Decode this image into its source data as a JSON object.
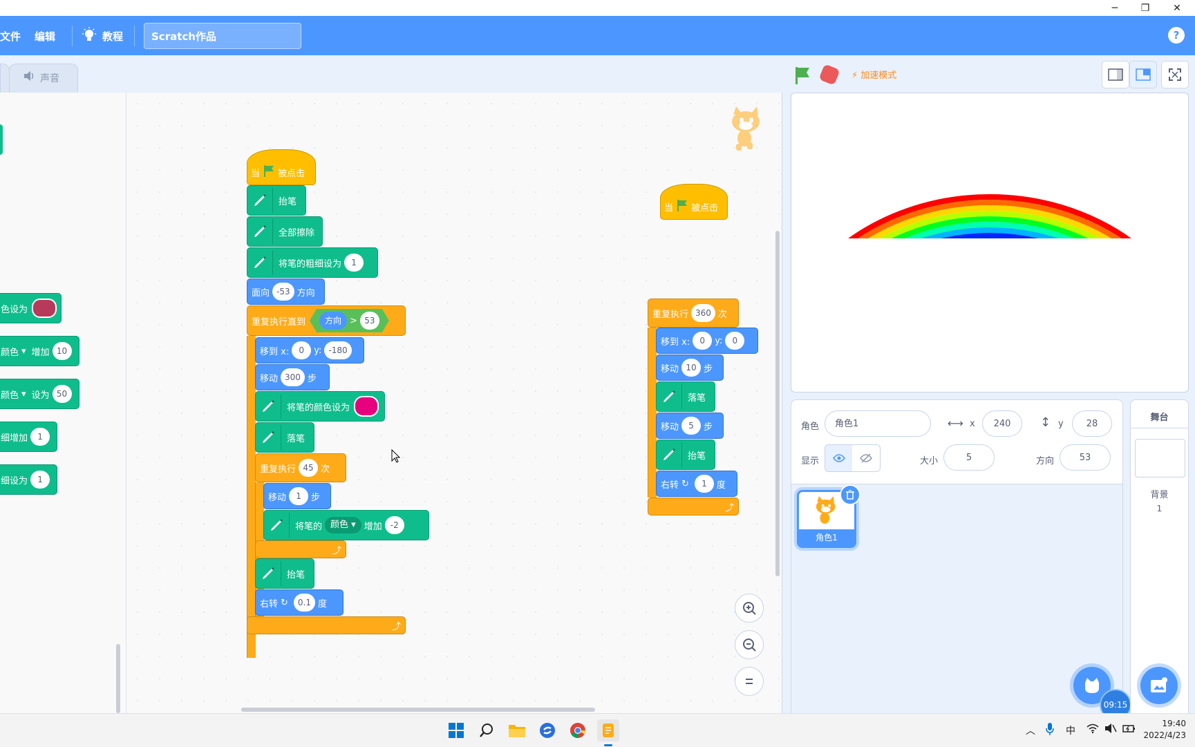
{
  "window": {
    "minimize_glyph": "─",
    "restore_glyph": "❐",
    "close_glyph": "✕"
  },
  "menu": {
    "file": "文件",
    "edit": "编辑",
    "tutorials": "教程",
    "project_title": "Scratch作品",
    "help": "?"
  },
  "tabs": {
    "sound": "声音"
  },
  "palette": {
    "items": [
      {
        "pre": "色设为"
      },
      {
        "pre": "颜色",
        "post": "增加",
        "value": "10"
      },
      {
        "pre": "颜色",
        "post": "设为",
        "value": "50"
      },
      {
        "pre": "细增加",
        "value": "1"
      },
      {
        "pre": "细设为",
        "value": "1"
      }
    ]
  },
  "script1": {
    "hat": {
      "when": "当",
      "clicked": "被点击"
    },
    "pen_up": "抬笔",
    "clear": "全部擦除",
    "set_size": {
      "label": "将笔的粗细设为",
      "value": "1"
    },
    "point": {
      "label": "面向",
      "value": "-53",
      "suffix": "方向"
    },
    "repeat_until": {
      "label": "重复执行直到",
      "reporter": "方向",
      "op": ">",
      "value": "53"
    },
    "goto": {
      "label": "移到 x:",
      "x": "0",
      "ylabel": "y:",
      "y": "-180"
    },
    "move": {
      "label": "移动",
      "value": "300",
      "suffix": "步"
    },
    "set_color": {
      "label": "将笔的颜色设为"
    },
    "pen_down": "落笔",
    "repeat": {
      "label": "重复执行",
      "value": "45",
      "suffix": "次"
    },
    "inner_move": {
      "label": "移动",
      "value": "1",
      "suffix": "步"
    },
    "change_color": {
      "label": "将笔的",
      "param": "颜色",
      "mid": "增加",
      "value": "-2"
    },
    "pen_up2": "抬笔",
    "turn": {
      "label": "右转",
      "value": "0.1",
      "suffix": "度"
    }
  },
  "script2": {
    "hat": {
      "when": "当",
      "clicked": "被点击"
    }
  },
  "script3": {
    "repeat": {
      "label": "重复执行",
      "value": "360",
      "suffix": "次"
    },
    "goto": {
      "label": "移到 x:",
      "x": "0",
      "ylabel": "y:",
      "y": "0"
    },
    "move1": {
      "label": "移动",
      "value": "10",
      "suffix": "步"
    },
    "pen_down": "落笔",
    "move2": {
      "label": "移动",
      "value": "5",
      "suffix": "步"
    },
    "pen_up": "抬笔",
    "turn": {
      "label": "右转",
      "value": "1",
      "suffix": "度"
    }
  },
  "stage_header": {
    "turbo": "加速模式"
  },
  "sprite_info": {
    "sprite_label": "角色",
    "sprite_name": "角色1",
    "x_label": "x",
    "x": "240",
    "y_label": "y",
    "y": "28",
    "show_label": "显示",
    "size_label": "大小",
    "size": "5",
    "direction_label": "方向",
    "direction": "53"
  },
  "sprites": [
    {
      "name": "角色1"
    }
  ],
  "stage_panel": {
    "title": "舞台",
    "backdrops_label": "背景",
    "backdrops_count": "1"
  },
  "timer_badge": "09:15",
  "taskbar": {
    "ime": "中",
    "time": "19:40",
    "date": "2022/4/23"
  },
  "colors": {
    "accent": "#4c97ff",
    "pen": "#0fbd8c",
    "motion": "#4c97ff",
    "control": "#ffab19",
    "events": "#ffbf00",
    "magenta": "#e6007e",
    "palette_swatch": "#b83a5a"
  }
}
